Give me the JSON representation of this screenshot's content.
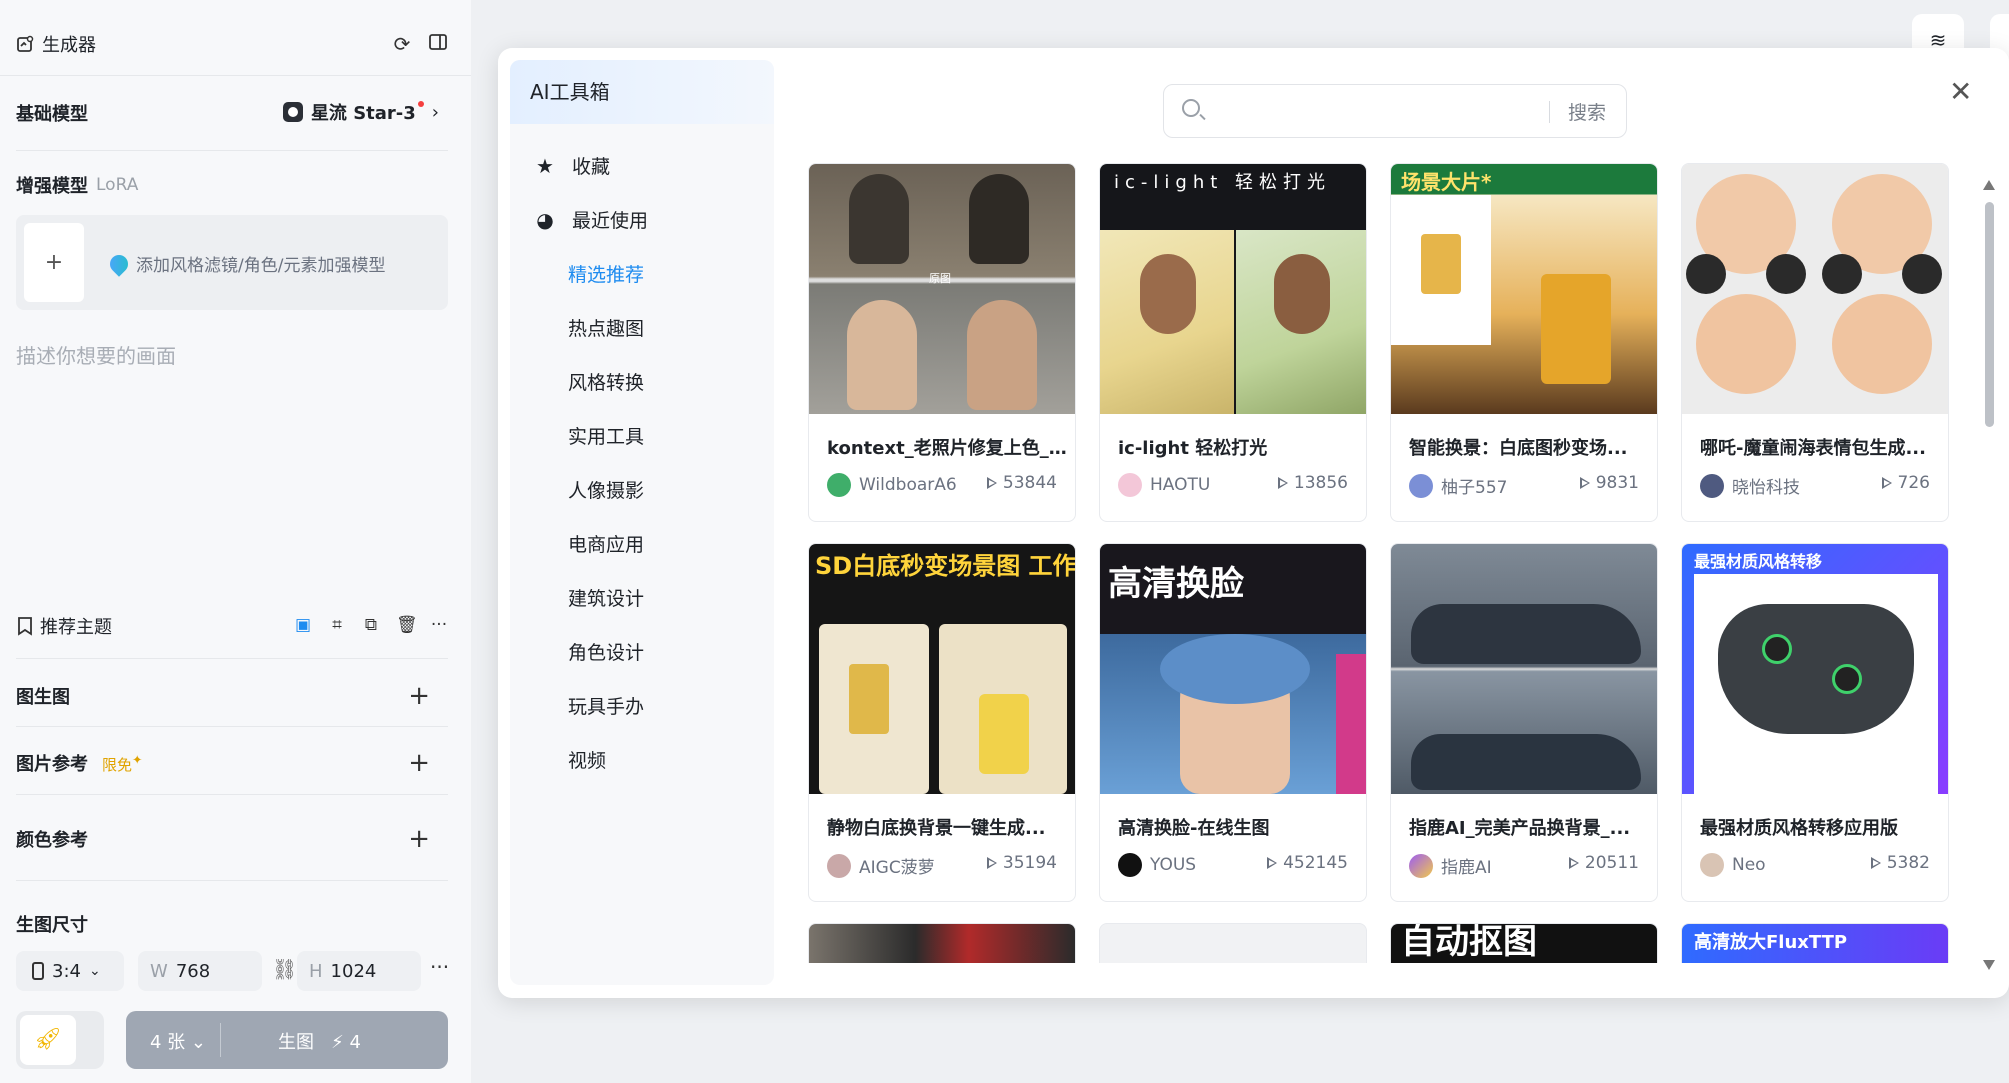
{
  "generator": {
    "title": "生成器",
    "base_model_label": "基础模型",
    "base_model_value": "星流 Star-3",
    "enhance_label": "增强模型",
    "enhance_sub": "LoRA",
    "lora_placeholder": "添加风格滤镜/角色/元素加强模型",
    "prompt_placeholder": "描述你想要的画面",
    "theme_label": "推荐主题",
    "sections": [
      {
        "label": "图生图"
      },
      {
        "label": "图片参考",
        "badge": "限免"
      },
      {
        "label": "颜色参考"
      }
    ],
    "size_label": "生图尺寸",
    "ratio": "3:4",
    "width_prefix": "W",
    "width": "768",
    "height_prefix": "H",
    "height": "1024",
    "count": "4 张",
    "generate": "生图",
    "cost": "4"
  },
  "modal": {
    "title": "AI工具箱",
    "nav": [
      {
        "label": "收藏",
        "icon": "star-icon"
      },
      {
        "label": "最近使用",
        "icon": "clock-icon"
      },
      {
        "label": "精选推荐",
        "active": true
      },
      {
        "label": "热点趣图"
      },
      {
        "label": "风格转换"
      },
      {
        "label": "实用工具"
      },
      {
        "label": "人像摄影"
      },
      {
        "label": "电商应用"
      },
      {
        "label": "建筑设计"
      },
      {
        "label": "角色设计"
      },
      {
        "label": "玩具手办"
      },
      {
        "label": "视频"
      }
    ],
    "search_button": "搜索",
    "search_value": "",
    "cards": [
      {
        "title": "kontext_老照片修复上色_...",
        "author": "WildboarA6",
        "plays": "53844",
        "overlay": "原图"
      },
      {
        "title": "ic-light 轻松打光",
        "author": "HAOTU",
        "plays": "13856",
        "overlay": "ic-light 轻松打光"
      },
      {
        "title": "智能换景：白底图秒变场...",
        "author": "柚子557",
        "plays": "9831",
        "overlay": "场景大片*"
      },
      {
        "title": "哪吒-魔童闹海表情包生成...",
        "author": "晓怡科技",
        "plays": "726"
      },
      {
        "title": "静物白底换背景一键生成...",
        "author": "AIGC菠萝",
        "plays": "35194",
        "overlay": "SD白底秒变场景图 工作流"
      },
      {
        "title": "高清换脸-在线生图",
        "author": "YOUS",
        "plays": "452145",
        "overlay": "高清换脸"
      },
      {
        "title": "指鹿AI_完美产品换背景_...",
        "author": "指鹿AI",
        "plays": "20511"
      },
      {
        "title": "最强材质风格转移应用版",
        "author": "Neo",
        "plays": "5382",
        "overlay": "最强材质风格转移"
      }
    ],
    "partial_cards": [
      {
        "overlay": ""
      },
      {
        "overlay": ""
      },
      {
        "overlay": "自动抠图"
      },
      {
        "overlay": "高清放大FluxTTP"
      }
    ]
  },
  "colors": {
    "accent": "#1f8cf0",
    "generate_button": "#9fa7b3",
    "badge": "#e0a300"
  }
}
